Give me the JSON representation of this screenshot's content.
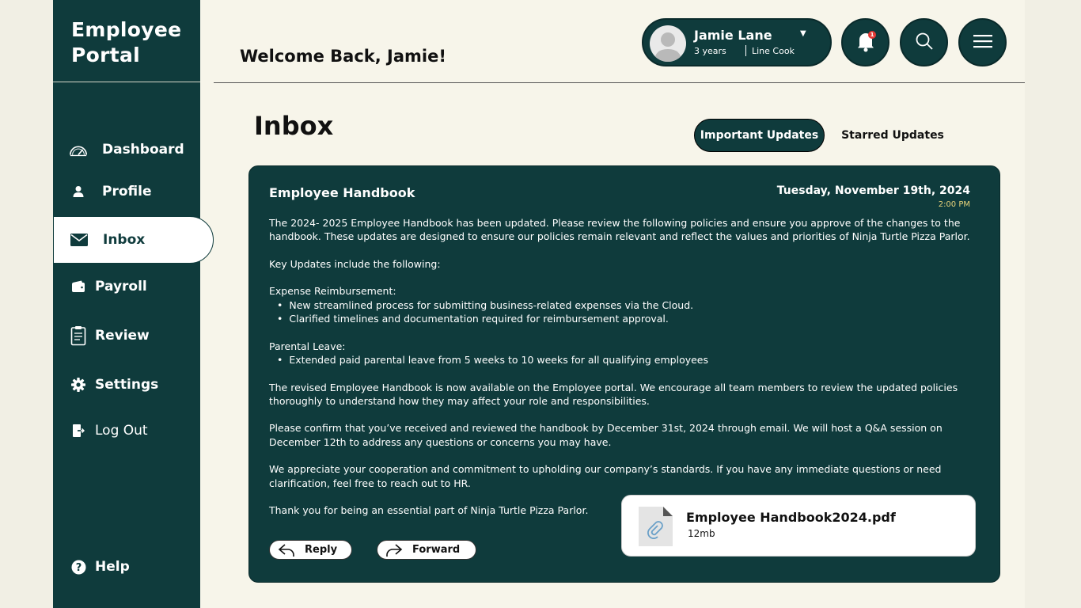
{
  "brand": {
    "line1": "Employee",
    "line2": "Portal"
  },
  "nav": {
    "dashboard": "Dashboard",
    "profile": "Profile",
    "inbox": "Inbox",
    "payroll": "Payroll",
    "review": "Review",
    "settings": "Settings",
    "logout": "Log Out",
    "help": "Help"
  },
  "header": {
    "welcome": "Welcome Back, Jamie!"
  },
  "user": {
    "name": "Jamie Lane",
    "tenure": "3 years",
    "role": "Line Cook"
  },
  "notifications": {
    "count": "1"
  },
  "inbox": {
    "title": "Inbox",
    "tabs": {
      "important": "Important Updates",
      "starred": "Starred Updates"
    }
  },
  "message": {
    "subject": "Employee Handbook",
    "date": "Tuesday, November 19th, 2024",
    "time": "2:00 PM",
    "p1": "The 2024- 2025 Employee Handbook has been updated. Please review the following policies and ensure you approve of the changes to the handbook. These updates are designed to ensure our policies remain relevant and reflect the values and priorities of Ninja Turtle Pizza Parlor.",
    "p2": "Key Updates include the following:",
    "expense_heading": "Expense Reimbursement:",
    "expense_1": "New streamlined process for submitting business-related expenses via the Cloud.",
    "expense_2": "Clarified timelines and documentation required for reimbursement approval.",
    "parental_heading": "Parental Leave:",
    "parental_1": "Extended paid parental leave from 5 weeks to 10 weeks for all qualifying employees",
    "p3": "The revised Employee Handbook is now available on the Employee portal. We encourage all team members to review the updated policies thoroughly to understand how they may affect your role and responsibilities.",
    "p4": "Please confirm that you’ve received and reviewed the handbook by December 31st, 2024 through email. We will host a Q&A session on December  12th to address any questions or concerns you may have.",
    "p5": "We appreciate your cooperation and commitment to upholding our company’s standards. If you have any immediate questions or need clarification, feel free to reach out to HR.",
    "p6": "Thank you for being an essential part of Ninja Turtle Pizza Parlor.",
    "attachment": {
      "name": "Employee Handbook2024.pdf",
      "size": "12mb"
    },
    "reply_label": "Reply",
    "forward_label": "Forward"
  },
  "colors": {
    "primary": "#0f3b3c",
    "background": "#f7f5ea",
    "accent": "#e6d27a"
  }
}
